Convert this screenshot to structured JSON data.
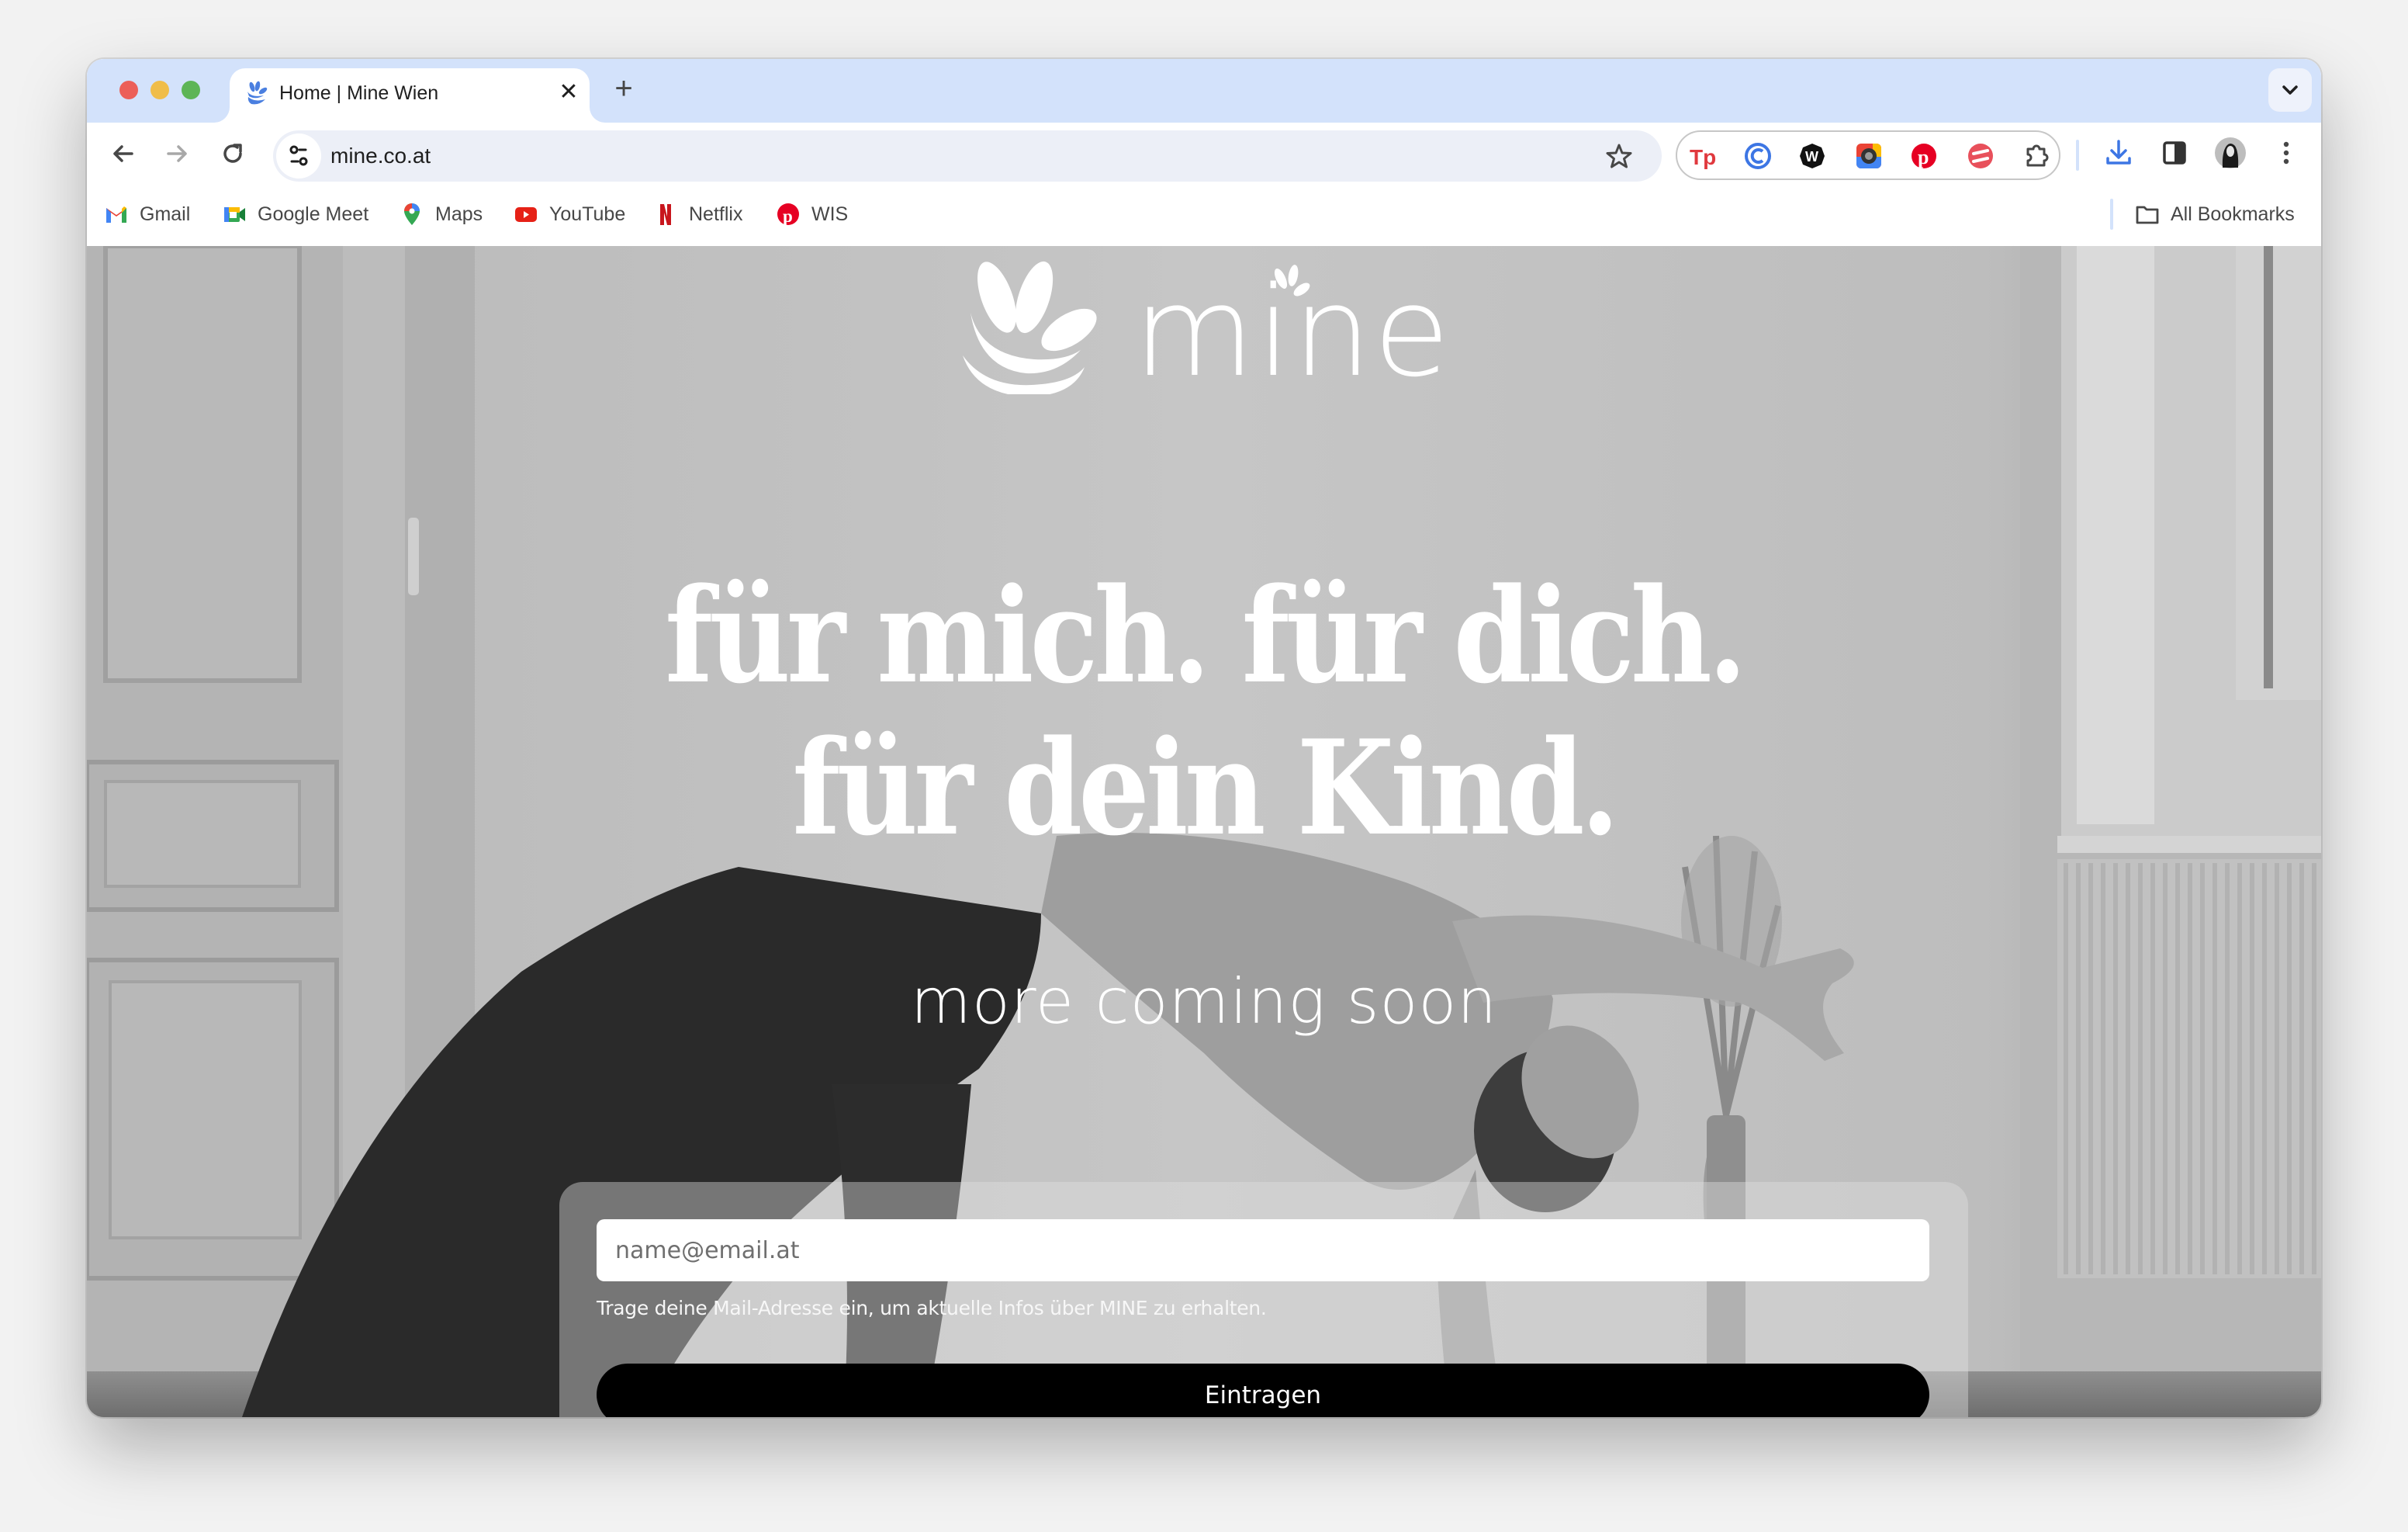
{
  "browser": {
    "tab": {
      "title": "Home | Mine Wien",
      "favicon": "mine-leaf-icon",
      "close_icon": "close-icon"
    },
    "new_tab_icon": "plus-icon",
    "tab_search_icon": "chevron-down-icon",
    "nav": {
      "back_icon": "arrow-left-icon",
      "forward_icon": "arrow-right-icon",
      "reload_icon": "reload-icon"
    },
    "omnibox": {
      "url": "mine.co.at",
      "site_info_icon": "tune-icon",
      "bookmark_icon": "star-icon"
    },
    "extensions": [
      {
        "name": "Tp",
        "icon": "tp-extension-icon"
      },
      {
        "name": "C",
        "icon": "c-extension-icon"
      },
      {
        "name": "W",
        "icon": "w-extension-icon"
      },
      {
        "name": "Camera",
        "icon": "camera-extension-icon"
      },
      {
        "name": "Pinterest",
        "icon": "pinterest-extension-icon"
      },
      {
        "name": "Stripes",
        "icon": "stripes-extension-icon"
      },
      {
        "name": "Extensions",
        "icon": "puzzle-icon"
      }
    ],
    "toolbar_right": [
      "download-icon",
      "side-panel-icon",
      "profile-avatar",
      "more-vert-icon"
    ],
    "bookmarks": [
      {
        "label": "Gmail",
        "icon": "gmail-icon"
      },
      {
        "label": "Google Meet",
        "icon": "google-meet-icon"
      },
      {
        "label": "Maps",
        "icon": "maps-icon"
      },
      {
        "label": "YouTube",
        "icon": "youtube-icon"
      },
      {
        "label": "Netflix",
        "icon": "netflix-icon"
      },
      {
        "label": "WIS",
        "icon": "pinterest-icon"
      }
    ],
    "all_bookmarks": {
      "label": "All Bookmarks",
      "icon": "folder-icon"
    },
    "colors": {
      "tabstrip": "#d3e2fb",
      "omnibox": "#eceff7",
      "favicon": "#4a7fe0"
    }
  },
  "page": {
    "logo_text": "mine",
    "headline": {
      "line1": "für mich. für dich.",
      "line2": "für dein Kind."
    },
    "subline": "more coming soon",
    "form": {
      "email_placeholder": "name@email.at",
      "email_value": "",
      "helper_text": "Trage deine Mail-Adresse ein, um aktuelle Infos über MINE zu erhalten.",
      "submit_label": "Eintragen"
    },
    "colors": {
      "text": "#ffffff",
      "button": "#000000"
    }
  }
}
